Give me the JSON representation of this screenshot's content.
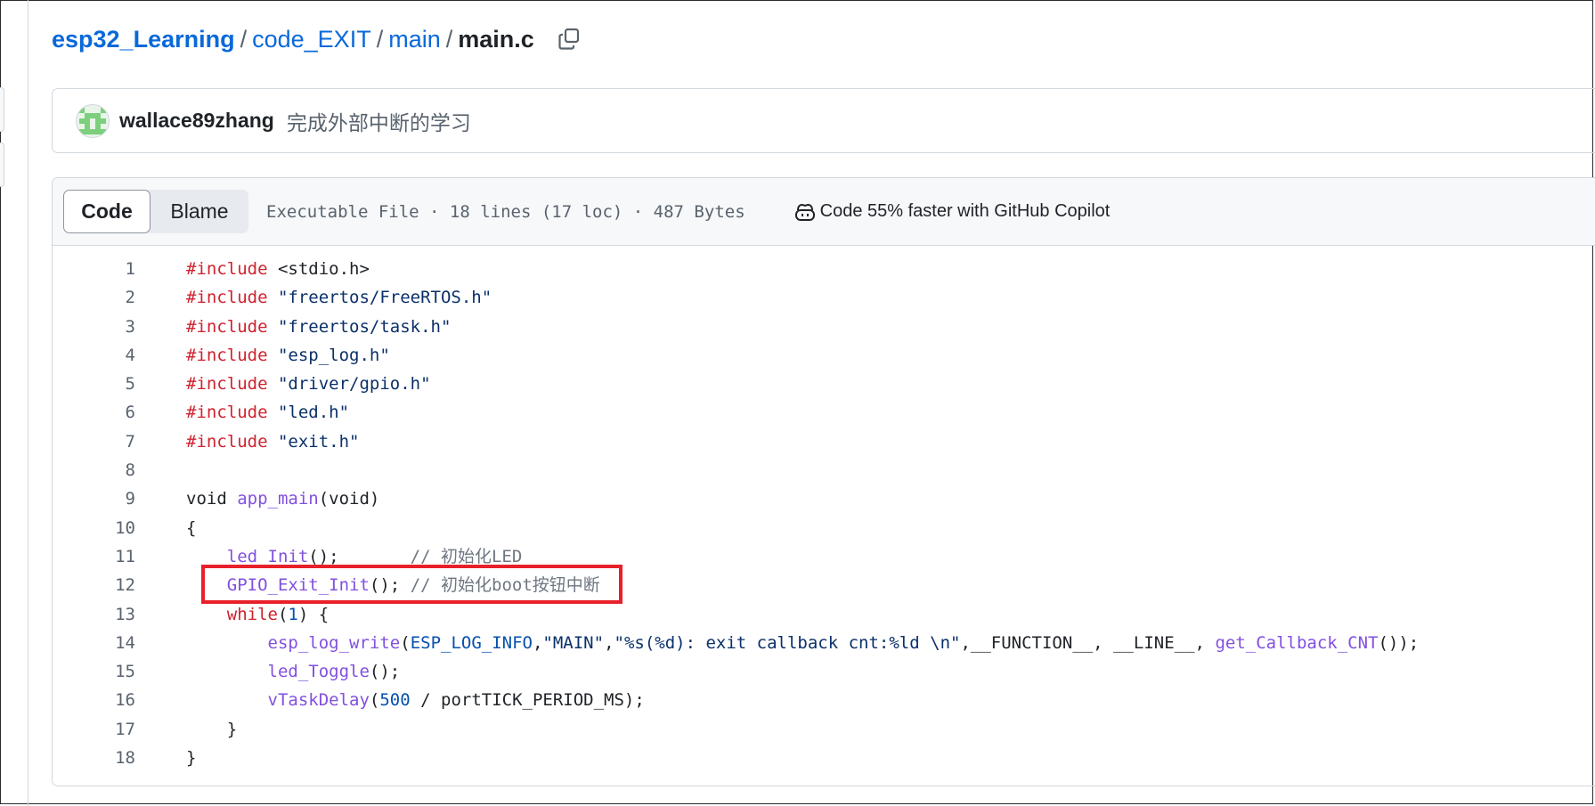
{
  "breadcrumb": {
    "repo": "esp32_Learning",
    "folder1": "code_EXIT",
    "folder2": "main",
    "file": "main.c",
    "sep1": "/",
    "sep2": "/",
    "sep3": "/",
    "copy_icon": "copy-icon"
  },
  "commit": {
    "author": "wallace89zhang",
    "message": "完成外部中断的学习",
    "avatar_icon": "identicon-avatar"
  },
  "file_header": {
    "tab_code": "Code",
    "tab_blame": "Blame",
    "info": "Executable File · 18 lines (17 loc) · 487 Bytes",
    "copilot_text": "Code 55% faster with GitHub Copilot",
    "copilot_icon": "copilot-icon"
  },
  "code_lines": [
    {
      "num": "1",
      "tokens": [
        {
          "t": "#include",
          "c": "kw"
        },
        {
          "t": " <stdio.h>",
          "c": ""
        }
      ]
    },
    {
      "num": "2",
      "tokens": [
        {
          "t": "#include",
          "c": "kw"
        },
        {
          "t": " ",
          "c": ""
        },
        {
          "t": "\"freertos/FreeRTOS.h\"",
          "c": "str"
        }
      ]
    },
    {
      "num": "3",
      "tokens": [
        {
          "t": "#include",
          "c": "kw"
        },
        {
          "t": " ",
          "c": ""
        },
        {
          "t": "\"freertos/task.h\"",
          "c": "str"
        }
      ]
    },
    {
      "num": "4",
      "tokens": [
        {
          "t": "#include",
          "c": "kw"
        },
        {
          "t": " ",
          "c": ""
        },
        {
          "t": "\"esp_log.h\"",
          "c": "str"
        }
      ]
    },
    {
      "num": "5",
      "tokens": [
        {
          "t": "#include",
          "c": "kw"
        },
        {
          "t": " ",
          "c": ""
        },
        {
          "t": "\"driver/gpio.h\"",
          "c": "str"
        }
      ]
    },
    {
      "num": "6",
      "tokens": [
        {
          "t": "#include",
          "c": "kw"
        },
        {
          "t": " ",
          "c": ""
        },
        {
          "t": "\"led.h\"",
          "c": "str"
        }
      ]
    },
    {
      "num": "7",
      "tokens": [
        {
          "t": "#include",
          "c": "kw"
        },
        {
          "t": " ",
          "c": ""
        },
        {
          "t": "\"exit.h\"",
          "c": "str"
        }
      ]
    },
    {
      "num": "8",
      "tokens": []
    },
    {
      "num": "9",
      "tokens": [
        {
          "t": "void ",
          "c": ""
        },
        {
          "t": "app_main",
          "c": "fn"
        },
        {
          "t": "(void)",
          "c": ""
        }
      ]
    },
    {
      "num": "10",
      "tokens": [
        {
          "t": "{",
          "c": ""
        }
      ]
    },
    {
      "num": "11",
      "tokens": [
        {
          "t": "    ",
          "c": ""
        },
        {
          "t": "led_Init",
          "c": "fn"
        },
        {
          "t": "();       ",
          "c": ""
        },
        {
          "t": "// 初始化LED",
          "c": "cm"
        }
      ]
    },
    {
      "num": "12",
      "tokens": [
        {
          "t": "    ",
          "c": ""
        },
        {
          "t": "GPIO_Exit_Init",
          "c": "fn"
        },
        {
          "t": "(); ",
          "c": ""
        },
        {
          "t": "// 初始化boot按钮中断",
          "c": "cm"
        }
      ]
    },
    {
      "num": "13",
      "tokens": [
        {
          "t": "    ",
          "c": ""
        },
        {
          "t": "while",
          "c": "kw"
        },
        {
          "t": "(",
          "c": ""
        },
        {
          "t": "1",
          "c": "num"
        },
        {
          "t": ") {",
          "c": ""
        }
      ]
    },
    {
      "num": "14",
      "tokens": [
        {
          "t": "        ",
          "c": ""
        },
        {
          "t": "esp_log_write",
          "c": "fn"
        },
        {
          "t": "(",
          "c": ""
        },
        {
          "t": "ESP_LOG_INFO",
          "c": "num"
        },
        {
          "t": ",",
          "c": ""
        },
        {
          "t": "\"MAIN\"",
          "c": "str"
        },
        {
          "t": ",",
          "c": ""
        },
        {
          "t": "\"%s(%d): exit callback cnt:%ld \\n\"",
          "c": "str"
        },
        {
          "t": ",__FUNCTION__, __LINE__, ",
          "c": ""
        },
        {
          "t": "get_Callback_CNT",
          "c": "fn"
        },
        {
          "t": "());",
          "c": ""
        }
      ]
    },
    {
      "num": "15",
      "tokens": [
        {
          "t": "        ",
          "c": ""
        },
        {
          "t": "led_Toggle",
          "c": "fn"
        },
        {
          "t": "();",
          "c": ""
        }
      ]
    },
    {
      "num": "16",
      "tokens": [
        {
          "t": "        ",
          "c": ""
        },
        {
          "t": "vTaskDelay",
          "c": "fn"
        },
        {
          "t": "(",
          "c": ""
        },
        {
          "t": "500",
          "c": "num"
        },
        {
          "t": " / portTICK_PERIOD_MS);",
          "c": ""
        }
      ]
    },
    {
      "num": "17",
      "tokens": [
        {
          "t": "    }",
          "c": ""
        }
      ]
    },
    {
      "num": "18",
      "tokens": [
        {
          "t": "}",
          "c": ""
        }
      ]
    }
  ],
  "highlighted_line": "12",
  "colors": {
    "link": "#0969da",
    "keyword": "#cf222e",
    "function": "#8250df",
    "string": "#0a3069",
    "highlight_border": "#e8202a"
  }
}
